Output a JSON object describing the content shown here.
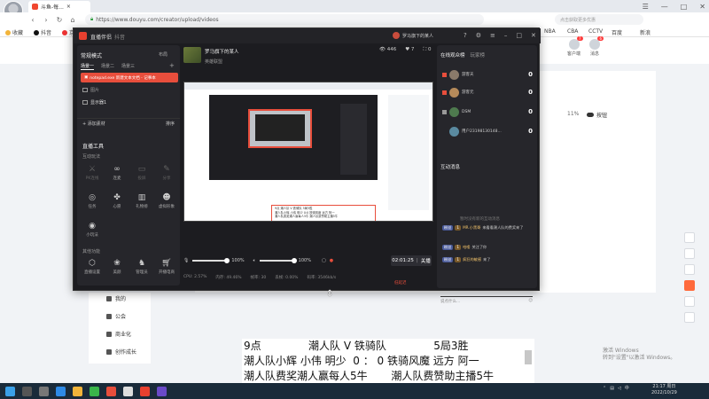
{
  "browser": {
    "tab_title": "斗鱼-每...",
    "url": "https://www.douyu.com/creator/upload/videos",
    "search_placeholder": "点击获取更多优惠",
    "bookmarks": [
      "收藏",
      "抖音",
      "京东...",
      "NBA",
      "CBA",
      "CCTV",
      "百度",
      "新浪"
    ]
  },
  "page": {
    "header_icons": [
      {
        "label": "客户端",
        "badge": "7"
      },
      {
        "label": "消息",
        "badge": "6"
      }
    ],
    "percent": "11%",
    "toggle_label": "按钮",
    "side_nav": [
      "我的",
      "公会",
      "商业化",
      "创作成长"
    ]
  },
  "app": {
    "title": "直播伴侣",
    "subtitle": "抖音",
    "username": "罗马旗下的某人",
    "mode": "常规模式",
    "layout_btn": "布局",
    "scenes": [
      "场景一",
      "场景二",
      "场景三"
    ],
    "active_source": "notepad.exe 新建文本文档 - 记事本",
    "sources": [
      "图片",
      "显示器1"
    ],
    "add_material": "+ 添加素材",
    "sort_label": "排序",
    "tools_title": "直播工具",
    "section_interact": "互动玩法",
    "tools_row1": [
      "PK连线",
      "连麦",
      "投屏",
      "分享"
    ],
    "tools_row2": [
      "任务",
      "心愿",
      "礼物榜",
      "虚拟形象"
    ],
    "tools_row3": [
      "小玩法"
    ],
    "section_other": "其他功能",
    "tools_row4": [
      "直播设置",
      "美颜",
      "管理员",
      "开播电商"
    ],
    "room_name": "罗马旗下的某人",
    "room_category": "英雄联盟",
    "room_stats": [
      "446",
      "7",
      "0"
    ],
    "audio_mic": "100%",
    "audio_speaker": "100%",
    "timer": "02:01:25",
    "timer_label": "关播",
    "status_items": [
      "CPU: 2.57%",
      "内存: 49.46%",
      "帧率: 30",
      "丢帧: 0.00%",
      "码率: 3546kb/s"
    ],
    "status_flag": "低延迟",
    "preview_text": [
      "9点        潮人队 V 铁骑队        5局3胜",
      "潮人队小辉 小伟 明少 0:0 铁骑风魔 远方 阿一",
      "潮人队费奖潮人赢每人5牛   潮人队费赞助主播5牛"
    ],
    "viewers_title": "在线观众榜",
    "viewers_tab2": "玩家榜",
    "viewers": [
      {
        "name": "游客天",
        "score": "0"
      },
      {
        "name": "游客元",
        "score": "0"
      },
      {
        "name": "DSM",
        "score": "0"
      },
      {
        "name": "用户23198130148...",
        "score": "0"
      }
    ],
    "chat_title": "互动消息",
    "chat_hint": "暂时没有新的互动消息",
    "chat": [
      {
        "tag": "粉丝",
        "level": "1",
        "name": "MR.小黑哥",
        "text": "来看看潮人队的费奖来了"
      },
      {
        "tag": "粉丝",
        "level": "1",
        "name": "哈喽",
        "text": "关注了你"
      },
      {
        "tag": "粉丝",
        "level": "1",
        "name": "疯狂的敏感",
        "text": "来了"
      }
    ],
    "chat_input": "说点什么..."
  },
  "editor": {
    "lines": [
      "9点              潮人队 V 铁骑队              5局3胜",
      "潮人队小辉 小伟 明少  0 ： 0 铁骑风魔 远方 阿一",
      "潮人队费奖潮人赢每人5牛       潮人队费赞助主播5牛"
    ]
  },
  "watermark": [
    "激活 Windows",
    "转到\"设置\"以激活 Windows。"
  ],
  "taskbar": {
    "time": "21:17",
    "day": "周日",
    "date": "2022/10/29",
    "lang": "中"
  }
}
